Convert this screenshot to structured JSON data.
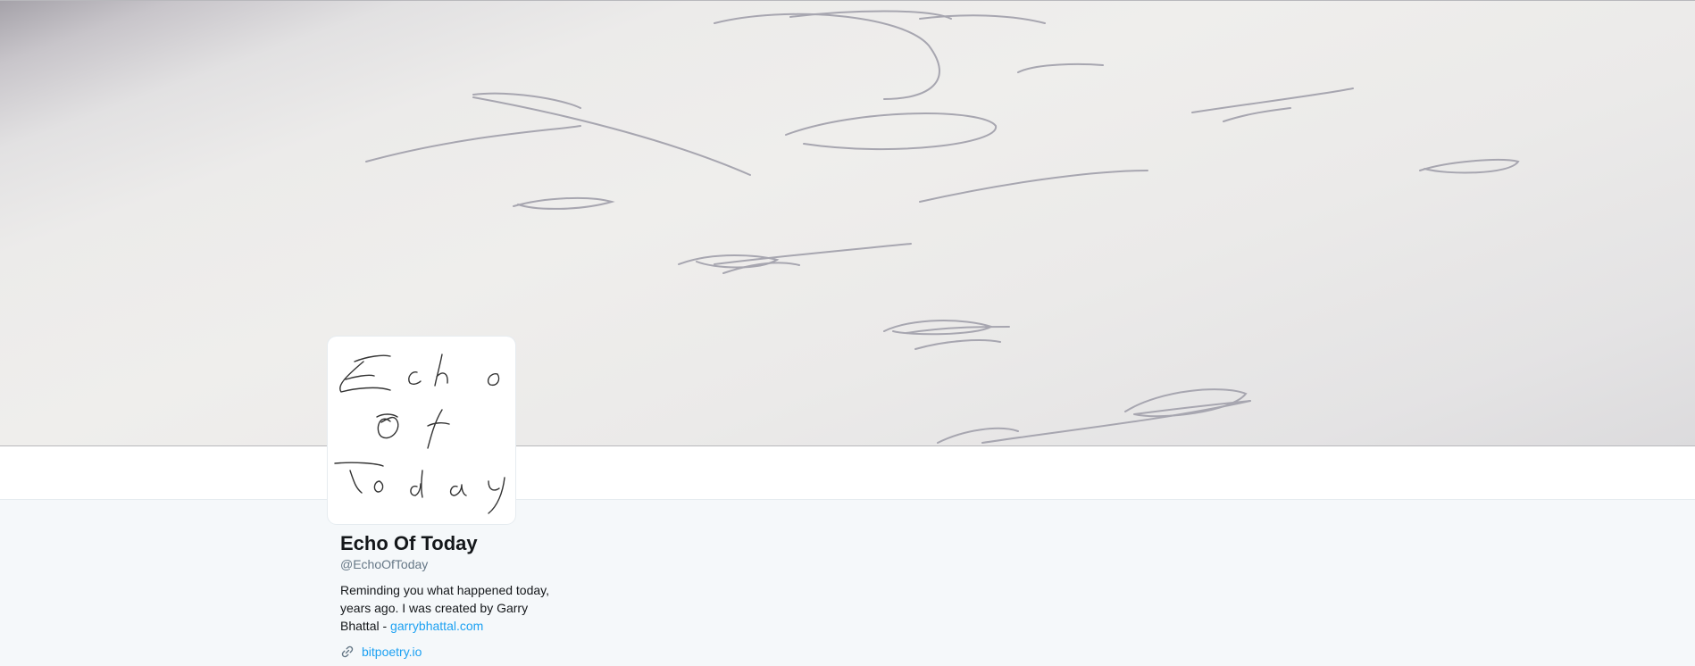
{
  "header": {
    "banner_image": "handwritten-script-letters-on-paper"
  },
  "avatar": {
    "image": "echo-of-today-script-logo",
    "text": "Echo Of Today"
  },
  "profile": {
    "name": "Echo Of Today",
    "handle": "@EchoOfToday",
    "bio_text": "Reminding you what happened today, years ago. I was created by Garry Bhattal - ",
    "bio_link": "garrybhattal.com",
    "website_link": "bitpoetry.io",
    "link_icon": "link-icon"
  },
  "colors": {
    "link": "#1da1f2",
    "name": "#14171a",
    "handle": "#657786",
    "page_background": "#f5f8fa"
  }
}
